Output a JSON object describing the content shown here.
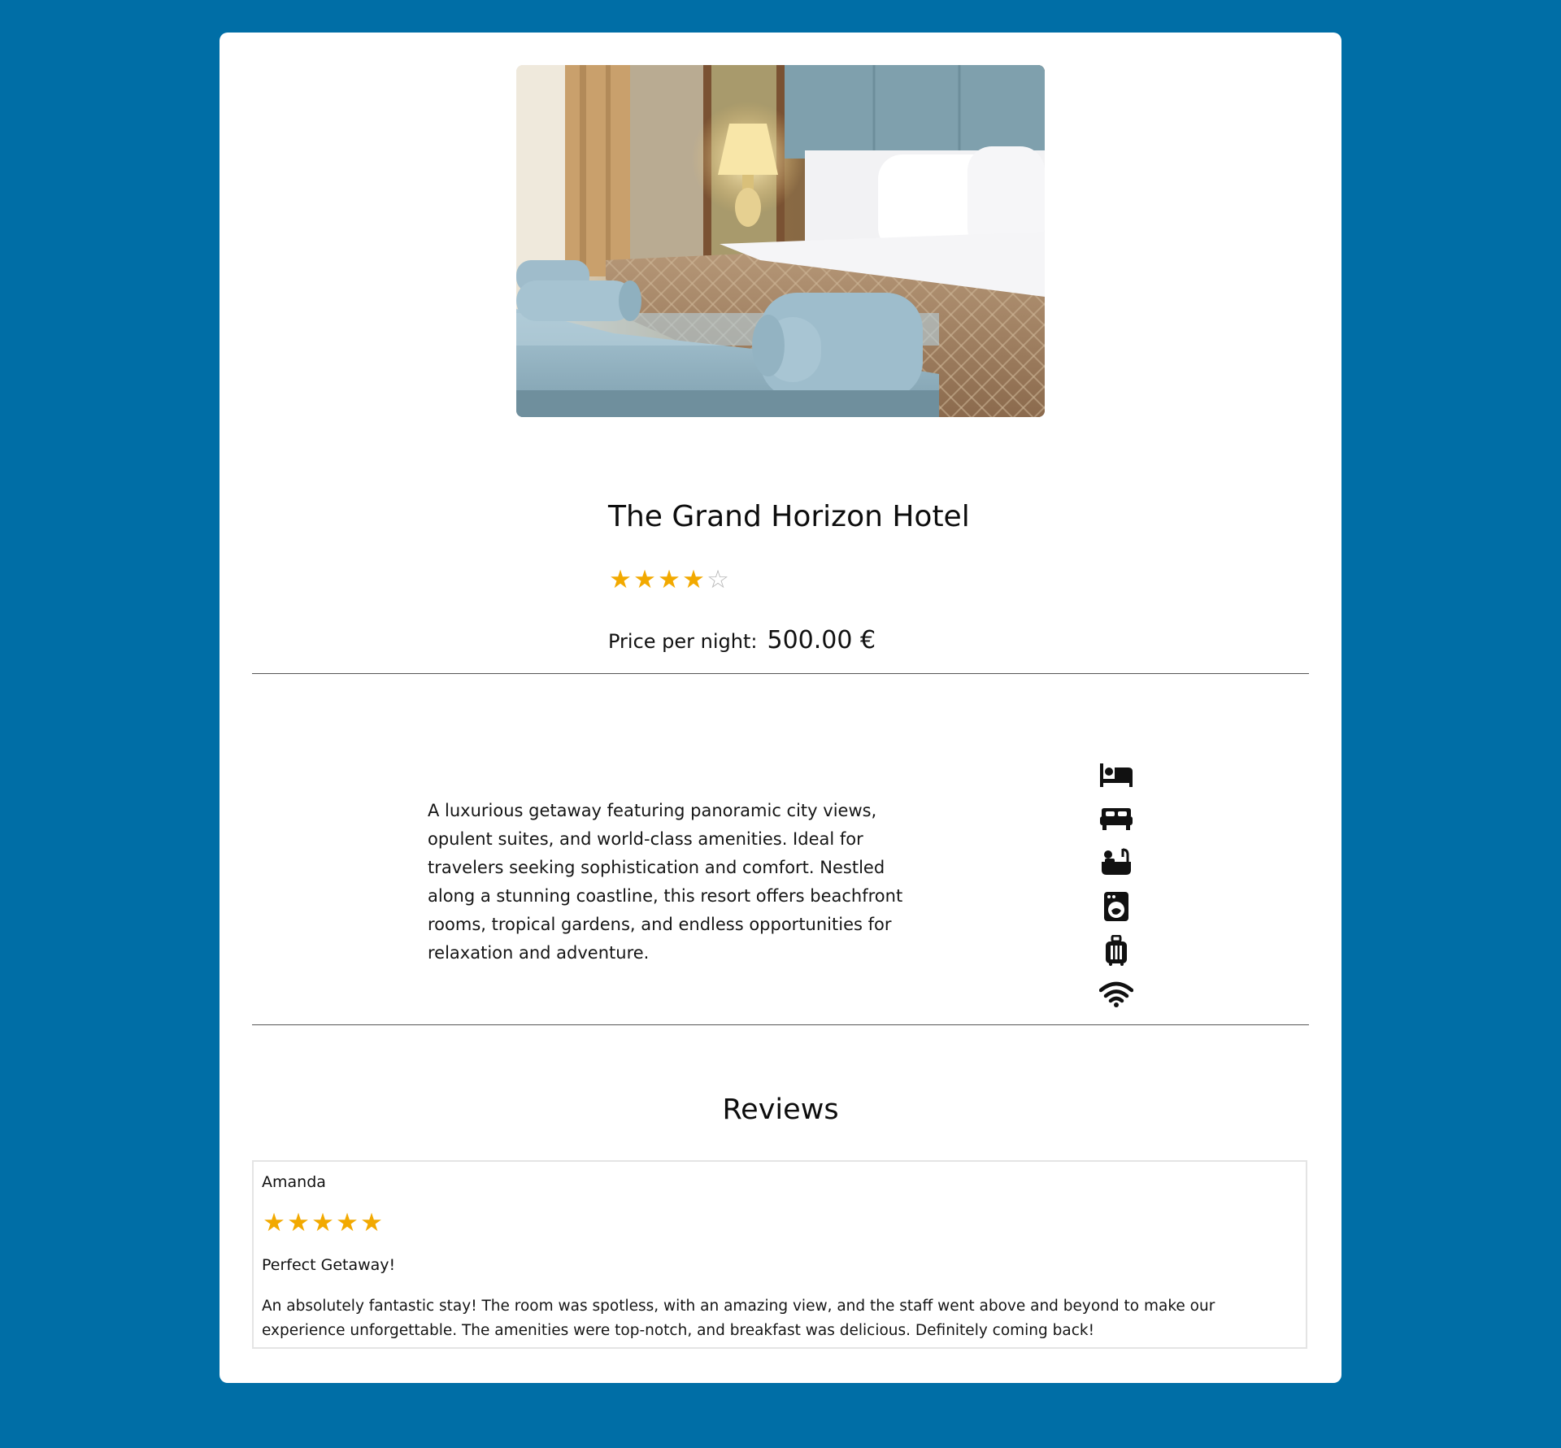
{
  "hotel": {
    "name": "The Grand Horizon Hotel",
    "rating": 4,
    "rating_max": 5,
    "price_label": "Price per night:",
    "price_value": "500.00 €",
    "description": "A luxurious getaway featuring panoramic city views, opulent suites, and world-class amenities. Ideal for travelers seeking sophistication and comfort. Nestled along a stunning coastline, this resort offers beachfront rooms, tropical gardens, and endless opportunities for relaxation and adventure.",
    "image_alt": "hotel-room-photo"
  },
  "amenities": [
    {
      "icon": "single-bed-icon"
    },
    {
      "icon": "double-bed-icon"
    },
    {
      "icon": "bathtub-icon"
    },
    {
      "icon": "washing-machine-icon"
    },
    {
      "icon": "luggage-icon"
    },
    {
      "icon": "wifi-icon"
    }
  ],
  "reviews": {
    "heading": "Reviews",
    "items": [
      {
        "author": "Amanda",
        "rating": 5,
        "rating_max": 5,
        "title": "Perfect Getaway!",
        "text": "An absolutely fantastic stay! The room was spotless, with an amazing view, and the staff went above and beyond to make our experience unforgettable. The amenities were top-notch, and breakfast was delicious. Definitely coming back!"
      }
    ]
  },
  "colors": {
    "page_background": "#006ea6",
    "card_background": "#ffffff",
    "star_filled": "#f2a900",
    "star_empty": "#b8b8b8",
    "divider": "#555555"
  }
}
